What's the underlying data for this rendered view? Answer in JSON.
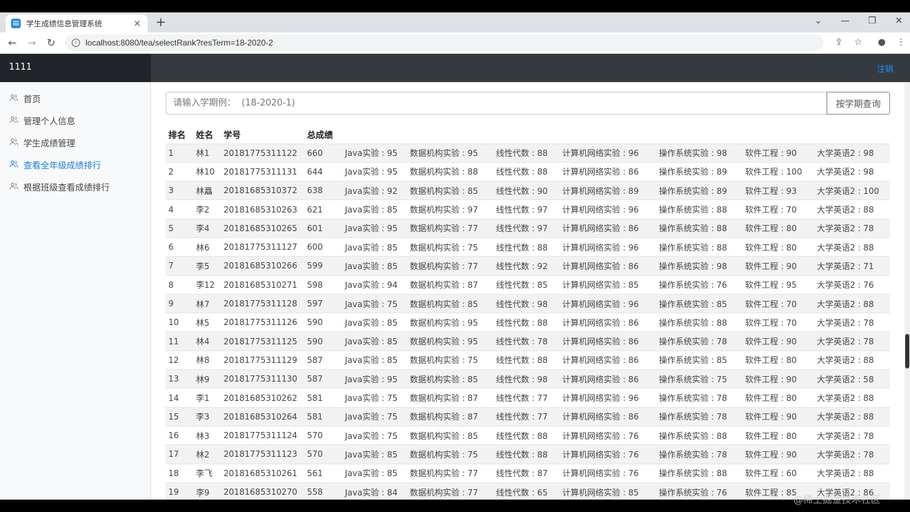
{
  "browser": {
    "tab_title": "学生成绩信息管理系统",
    "tab_close": "×",
    "new_tab": "+",
    "url": "localhost:8080/tea/selectRank?resTerm=18-2020-2",
    "win_minimize": "—",
    "win_restore": "❐",
    "win_close": "✕",
    "nav_back": "←",
    "nav_forward": "→",
    "nav_reload": "↻",
    "share_icon": "⇪",
    "star_icon": "☆",
    "profile_icon": "●",
    "menu_icon": "⋮"
  },
  "header": {
    "brand": "1111",
    "logout": "注销"
  },
  "sidebar": {
    "items": [
      {
        "label": "首页"
      },
      {
        "label": "管理个人信息"
      },
      {
        "label": "学生成绩管理"
      },
      {
        "label": "查看全年级成绩排行"
      },
      {
        "label": "根据班级查看成绩排行"
      }
    ]
  },
  "search": {
    "placeholder": "请输入学期例：  (18-2020-1)",
    "button": "按学期查询"
  },
  "table": {
    "headers": [
      "排名",
      "姓名",
      "学号",
      "总成绩"
    ],
    "rows": [
      [
        "1",
        "林1",
        "20181775311122",
        "660",
        "Java实验 : 95",
        "数据机构实验 : 95",
        "线性代数 : 88",
        "计算机网络实验 : 96",
        "操作系统实验 : 98",
        "软件工程 : 90",
        "大学英语2 : 98"
      ],
      [
        "2",
        "林10",
        "20181775311131",
        "644",
        "Java实验 : 95",
        "数据机构实验 : 88",
        "线性代数 : 88",
        "计算机网络实验 : 86",
        "操作系统实验 : 89",
        "软件工程 : 100",
        "大学英语2 : 98"
      ],
      [
        "3",
        "林矗",
        "20181685310372",
        "638",
        "Java实验 : 92",
        "数据机构实验 : 85",
        "线性代数 : 90",
        "计算机网络实验 : 89",
        "操作系统实验 : 89",
        "软件工程 : 93",
        "大学英语2 : 100"
      ],
      [
        "4",
        "李2",
        "20181685310263",
        "621",
        "Java实验 : 85",
        "数据机构实验 : 97",
        "线性代数 : 97",
        "计算机网络实验 : 96",
        "操作系统实验 : 88",
        "软件工程 : 70",
        "大学英语2 : 88"
      ],
      [
        "5",
        "李4",
        "20181685310265",
        "601",
        "Java实验 : 95",
        "数据机构实验 : 77",
        "线性代数 : 97",
        "计算机网络实验 : 86",
        "操作系统实验 : 88",
        "软件工程 : 80",
        "大学英语2 : 78"
      ],
      [
        "6",
        "林6",
        "20181775311127",
        "600",
        "Java实验 : 85",
        "数据机构实验 : 75",
        "线性代数 : 88",
        "计算机网络实验 : 96",
        "操作系统实验 : 88",
        "软件工程 : 80",
        "大学英语2 : 88"
      ],
      [
        "7",
        "李5",
        "20181685310266",
        "599",
        "Java实验 : 85",
        "数据机构实验 : 77",
        "线性代数 : 92",
        "计算机网络实验 : 86",
        "操作系统实验 : 98",
        "软件工程 : 90",
        "大学英语2 : 71"
      ],
      [
        "8",
        "李12",
        "20181685310271",
        "598",
        "Java实验 : 94",
        "数据机构实验 : 87",
        "线性代数 : 85",
        "计算机网络实验 : 85",
        "操作系统实验 : 76",
        "软件工程 : 95",
        "大学英语2 : 76"
      ],
      [
        "9",
        "林7",
        "20181775311128",
        "597",
        "Java实验 : 75",
        "数据机构实验 : 85",
        "线性代数 : 98",
        "计算机网络实验 : 96",
        "操作系统实验 : 85",
        "软件工程 : 70",
        "大学英语2 : 88"
      ],
      [
        "10",
        "林5",
        "20181775311126",
        "590",
        "Java实验 : 85",
        "数据机构实验 : 95",
        "线性代数 : 88",
        "计算机网络实验 : 86",
        "操作系统实验 : 88",
        "软件工程 : 70",
        "大学英语2 : 78"
      ],
      [
        "11",
        "林4",
        "20181775311125",
        "590",
        "Java实验 : 85",
        "数据机构实验 : 95",
        "线性代数 : 78",
        "计算机网络实验 : 86",
        "操作系统实验 : 78",
        "软件工程 : 90",
        "大学英语2 : 78"
      ],
      [
        "12",
        "林8",
        "20181775311129",
        "587",
        "Java实验 : 85",
        "数据机构实验 : 75",
        "线性代数 : 88",
        "计算机网络实验 : 86",
        "操作系统实验 : 85",
        "软件工程 : 80",
        "大学英语2 : 88"
      ],
      [
        "13",
        "林9",
        "20181775311130",
        "587",
        "Java实验 : 95",
        "数据机构实验 : 85",
        "线性代数 : 98",
        "计算机网络实验 : 86",
        "操作系统实验 : 75",
        "软件工程 : 90",
        "大学英语2 : 58"
      ],
      [
        "14",
        "李1",
        "20181685310262",
        "581",
        "Java实验 : 75",
        "数据机构实验 : 87",
        "线性代数 : 77",
        "计算机网络实验 : 96",
        "操作系统实验 : 78",
        "软件工程 : 80",
        "大学英语2 : 88"
      ],
      [
        "15",
        "李3",
        "20181685310264",
        "581",
        "Java实验 : 75",
        "数据机构实验 : 87",
        "线性代数 : 77",
        "计算机网络实验 : 86",
        "操作系统实验 : 78",
        "软件工程 : 90",
        "大学英语2 : 88"
      ],
      [
        "16",
        "林3",
        "20181775311124",
        "570",
        "Java实验 : 75",
        "数据机构实验 : 85",
        "线性代数 : 88",
        "计算机网络实验 : 76",
        "操作系统实验 : 88",
        "软件工程 : 80",
        "大学英语2 : 78"
      ],
      [
        "17",
        "林2",
        "20181775311123",
        "570",
        "Java实验 : 85",
        "数据机构实验 : 75",
        "线性代数 : 88",
        "计算机网络实验 : 76",
        "操作系统实验 : 78",
        "软件工程 : 90",
        "大学英语2 : 78"
      ],
      [
        "18",
        "李飞",
        "20181685310261",
        "561",
        "Java实验 : 85",
        "数据机构实验 : 77",
        "线性代数 : 87",
        "计算机网络实验 : 76",
        "操作系统实验 : 88",
        "软件工程 : 60",
        "大学英语2 : 88"
      ],
      [
        "19",
        "李9",
        "20181685310270",
        "558",
        "Java实验 : 84",
        "数据机构实验 : 77",
        "线性代数 : 65",
        "计算机网络实验 : 85",
        "操作系统实验 : 76",
        "软件工程 : 85",
        "大学英语2 : 86"
      ]
    ]
  },
  "watermark": "@稀土掘金技术社区",
  "colors": {
    "header_bg": "#343a40",
    "active_link": "#1e7fd6",
    "logout_link": "#1e90ff"
  }
}
